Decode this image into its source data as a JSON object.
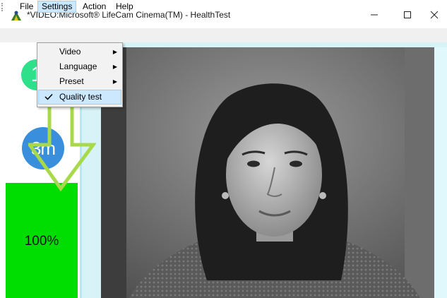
{
  "window": {
    "title": "*VIDEO:Microsoft® LifeCam Cinema(TM) - HealthTest",
    "icon": "camera-app-icon",
    "controls": {
      "minimize": "—",
      "maximize": "☐",
      "close": "✕"
    }
  },
  "menubar": {
    "items": [
      {
        "label": "File"
      },
      {
        "label": "Settings"
      },
      {
        "label": "Action"
      },
      {
        "label": "Help"
      }
    ]
  },
  "dropdown": {
    "items": [
      {
        "label": "Video",
        "has_submenu": true
      },
      {
        "label": "Language",
        "has_submenu": true
      },
      {
        "label": "Preset",
        "has_submenu": true
      },
      {
        "label": "Quality test",
        "checked": true
      }
    ],
    "submenu_arrow": "▶"
  },
  "sidebar": {
    "badge_1": "1",
    "badge_2": "3m",
    "progress": {
      "label": "100%",
      "value": 1.0
    },
    "overlay_arrow_icon": "down-arrow-outline-icon"
  },
  "video": {
    "description_icon": "webcam-feed"
  },
  "colors": {
    "progress_green": "#00dd00",
    "badge_1_color": "#2ee08a",
    "badge_2_color": "#3a8fdd",
    "arrow_color": "#a8d94a",
    "menu_highlight": "#cce8ff"
  }
}
